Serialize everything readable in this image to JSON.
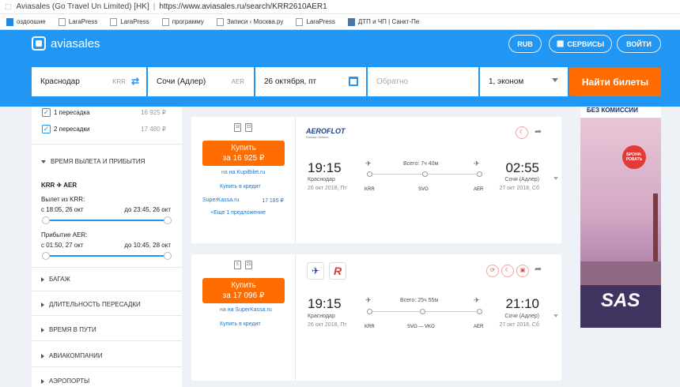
{
  "browser": {
    "site": "Aviasales (Go Travel Un Limited) [HK]",
    "url": "https://www.aviasales.ru/search/KRR2610AER1"
  },
  "bookmarks": [
    "оздоошие",
    "LaraPress",
    "LaraPress",
    "программу",
    "Записи ‹ Москва.ру",
    "LaraPress",
    "ДТП и ЧП | Санкт-Пе"
  ],
  "header": {
    "logo": "aviasales",
    "currency": "RUB",
    "services": "СЕРВИСЫ",
    "login": "ВОЙТИ"
  },
  "search": {
    "origin": "Краснодар",
    "origin_code": "KRR",
    "dest": "Сочи (Адлер)",
    "dest_code": "AER",
    "date": "26 октября, пт",
    "return_placeholder": "Обратно",
    "passengers": "1, эконом",
    "find": "Найти билеты"
  },
  "filters": {
    "stops": [
      {
        "label": "1 пересадка",
        "price": "16 925 ₽"
      },
      {
        "label": "2 пересадки",
        "price": "17 480 ₽"
      }
    ],
    "time_section": "ВРЕМЯ ВЫЛЕТА И ПРИБЫТИЯ",
    "route_from": "KRR",
    "route_to": "AER",
    "dep_title": "Вылет из KRR:",
    "dep_from": "с 18:05, 26 окт",
    "dep_to": "до 23:45, 26 окт",
    "arr_title": "Прибытие AER:",
    "arr_from": "с 01:50, 27 окт",
    "arr_to": "до 10:45, 28 окт",
    "sections": [
      "БАГАЖ",
      "ДЛИТЕЛЬНОСТЬ ПЕРЕСАДКИ",
      "ВРЕМЯ В ПУТИ",
      "АВИАКОМПАНИИ",
      "АЭРОПОРТЫ"
    ]
  },
  "tickets": [
    {
      "bag1": "10",
      "bag2": "23",
      "buy1": "Купить",
      "buy2": "за 16 925 ₽",
      "on": "на KupiBilet.ru",
      "credit": "Купить в кредит",
      "alt_agency": "SuperKassa.ru",
      "alt_price": "17 185 ₽",
      "more": "+Еще 1 предложение",
      "airline": "AEROFLOT",
      "airline_sub": "Russian Airlines",
      "dep_time": "19:15",
      "dep_city": "Краснодар",
      "dep_date": "26 окт 2018, Пт",
      "total": "Всего: 7ч 40м",
      "arr_time": "02:55",
      "arr_city": "Сочи (Адлер)",
      "arr_date": "27 окт 2018, Сб",
      "ap_from": "KRR",
      "ap_mid": "SVO",
      "ap_to": "AER"
    },
    {
      "bag1": "5",
      "bag2": "23",
      "buy1": "Купить",
      "buy2": "за 17 096 ₽",
      "on": "на SuperKassa.ru",
      "credit": "Купить в кредит",
      "dep_time": "19:15",
      "dep_city": "Краснодар",
      "dep_date": "26 окт 2018, Пт",
      "total": "Всего: 25ч 55м",
      "arr_time": "21:10",
      "arr_city": "Сочи (Адлер)",
      "arr_date": "27 окт 2018, Сб",
      "ap_from": "KRR",
      "ap_mid": "SVO — VKO",
      "ap_to": "AER"
    }
  ],
  "ad": {
    "top": "БЕЗ КОМИССИИ",
    "badge1": "БРОНИ-",
    "badge2": "РОВАТЬ",
    "brand": "SAS"
  }
}
